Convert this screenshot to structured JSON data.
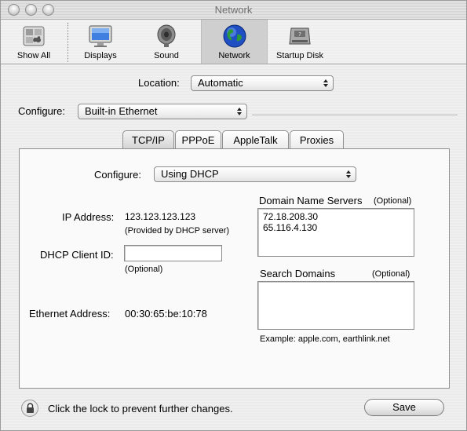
{
  "window": {
    "title": "Network"
  },
  "toolbar": {
    "items": [
      {
        "label": "Show All",
        "icon": "show-all-icon"
      },
      {
        "label": "Displays",
        "icon": "displays-icon"
      },
      {
        "label": "Sound",
        "icon": "sound-icon"
      },
      {
        "label": "Network",
        "icon": "network-globe-icon",
        "selected": true
      },
      {
        "label": "Startup Disk",
        "icon": "startup-disk-icon"
      }
    ]
  },
  "location": {
    "label": "Location:",
    "value": "Automatic"
  },
  "configure_top": {
    "label": "Configure:",
    "value": "Built-in Ethernet"
  },
  "tabs": [
    {
      "label": "TCP/IP",
      "active": true
    },
    {
      "label": "PPPoE"
    },
    {
      "label": "AppleTalk"
    },
    {
      "label": "Proxies"
    }
  ],
  "tcpip": {
    "configure_label": "Configure:",
    "configure_value": "Using DHCP",
    "ip_label": "IP Address:",
    "ip_value": "123.123.123.123",
    "ip_note": "(Provided by DHCP server)",
    "dhcp_label": "DHCP Client ID:",
    "dhcp_value": "",
    "dhcp_note": "(Optional)",
    "ethernet_label": "Ethernet Address:",
    "ethernet_value": "00:30:65:be:10:78",
    "dns_label": "Domain Name Servers",
    "dns_optional": "(Optional)",
    "dns_servers": [
      "72.18.208.30",
      "65.116.4.130"
    ],
    "search_label": "Search Domains",
    "search_optional": "(Optional)",
    "search_value": "",
    "example": "Example: apple.com, earthlink.net"
  },
  "footer": {
    "lock_text": "Click the lock to prevent further changes.",
    "save_label": "Save"
  },
  "colors": {
    "selected_toolbar_bg": "#cfcfcf",
    "globe_blue": "#1f4fc2"
  }
}
